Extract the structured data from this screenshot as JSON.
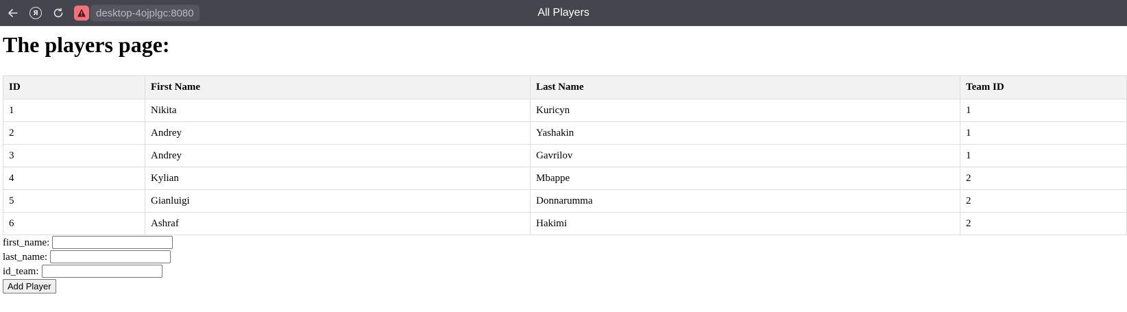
{
  "browser": {
    "url": "desktop-4ojplgc:8080",
    "tab_title": "All Players",
    "icons": [
      "back-arrow-icon",
      "yandex-icon",
      "reload-icon",
      "warning-icon"
    ]
  },
  "page": {
    "heading": "The players page:"
  },
  "table": {
    "headers": [
      "ID",
      "First Name",
      "Last Name",
      "Team ID"
    ],
    "rows": [
      [
        "1",
        "Nikita",
        "Kuricyn",
        "1"
      ],
      [
        "2",
        "Andrey",
        "Yashakin",
        "1"
      ],
      [
        "3",
        "Andrey",
        "Gavrilov",
        "1"
      ],
      [
        "4",
        "Kylian",
        "Mbappe",
        "2"
      ],
      [
        "5",
        "Gianluigi",
        "Donnarumma",
        "2"
      ],
      [
        "6",
        "Ashraf",
        "Hakimi",
        "2"
      ]
    ]
  },
  "form": {
    "first_name_label": "first_name:",
    "first_name_value": "",
    "last_name_label": "last_name:",
    "last_name_value": "",
    "id_team_label": "id_team:",
    "id_team_value": "",
    "submit_label": "Add Player"
  }
}
